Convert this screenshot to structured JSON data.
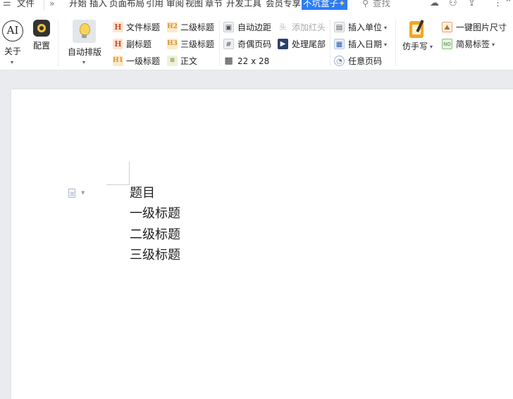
{
  "menubar": {
    "file_label": "文件",
    "more_glyph": "»",
    "tabs": [
      "开始",
      "插入",
      "页面布局",
      "引用",
      "审阅",
      "视图",
      "章节",
      "开发工具",
      "会员专享"
    ],
    "active_tab": "不坑盒子",
    "search_label": "查找"
  },
  "ribbon": {
    "about_label": "关于",
    "config_label": "配置",
    "auto_layout_label": "自动排版",
    "headings": {
      "doc_title": "文件标题",
      "sub_title": "副标题",
      "level1": "一级标题",
      "level2": "二级标题",
      "level3": "三级标题",
      "body": "正文"
    },
    "page_tools": {
      "auto_margin": "自动边距",
      "add_red_header": "添加红头",
      "odd_even_page": "奇偶页码",
      "process_tail": "处理尾部",
      "grid_size": "22 x 28"
    },
    "insert_tools": {
      "insert_unit": "插入单位",
      "insert_date": "插入日期",
      "any_page_number": "任意页码"
    },
    "handwrite_label": "仿手写",
    "one_click_image_size": "一键图片尺寸",
    "simple_tag": "简易标签",
    "icon_glyphs": {
      "about": "AI",
      "heading_h": "H",
      "heading_h1": "H1",
      "heading_h2": "H2",
      "heading_h3": "H3"
    }
  },
  "document": {
    "lines": [
      "题目",
      "一级标题",
      "二级标题",
      "三级标题"
    ]
  },
  "colors": {
    "accent": "#2d7cf6",
    "ribbon_bg": "#ffffff",
    "canvas_bg": "#e9ebee"
  }
}
